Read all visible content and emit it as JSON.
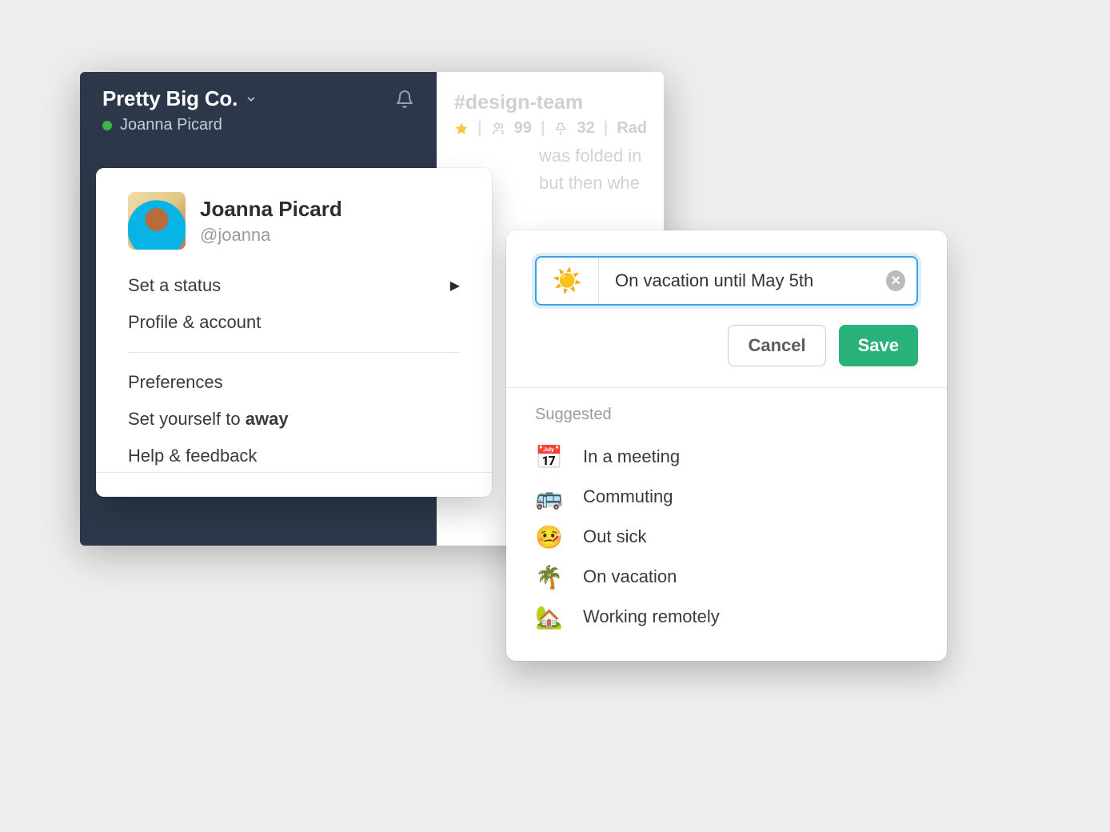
{
  "workspace": {
    "name": "Pretty Big Co.",
    "user": "Joanna Picard"
  },
  "channel": {
    "name": "#design-team",
    "members": "99",
    "pinned": "32",
    "topic_fragment": "Rad",
    "body_line1": "was folded in",
    "body_line2": "but then whe"
  },
  "menu": {
    "user": {
      "name": "Joanna Picard",
      "handle": "@joanna"
    },
    "items": {
      "set_status": "Set a status",
      "profile": "Profile & account",
      "preferences": "Preferences",
      "set_away_prefix": "Set yourself to ",
      "set_away_bold": "away",
      "help": "Help & feedback"
    }
  },
  "status": {
    "emoji": "☀️",
    "text": "On vacation until May 5th",
    "cancel": "Cancel",
    "save": "Save",
    "suggested_label": "Suggested",
    "suggestions": [
      {
        "emoji": "📅",
        "label": "In a meeting"
      },
      {
        "emoji": "🚌",
        "label": "Commuting"
      },
      {
        "emoji": "🤒",
        "label": "Out sick"
      },
      {
        "emoji": "🌴",
        "label": "On vacation"
      },
      {
        "emoji": "🏡",
        "label": "Working remotely"
      }
    ]
  }
}
